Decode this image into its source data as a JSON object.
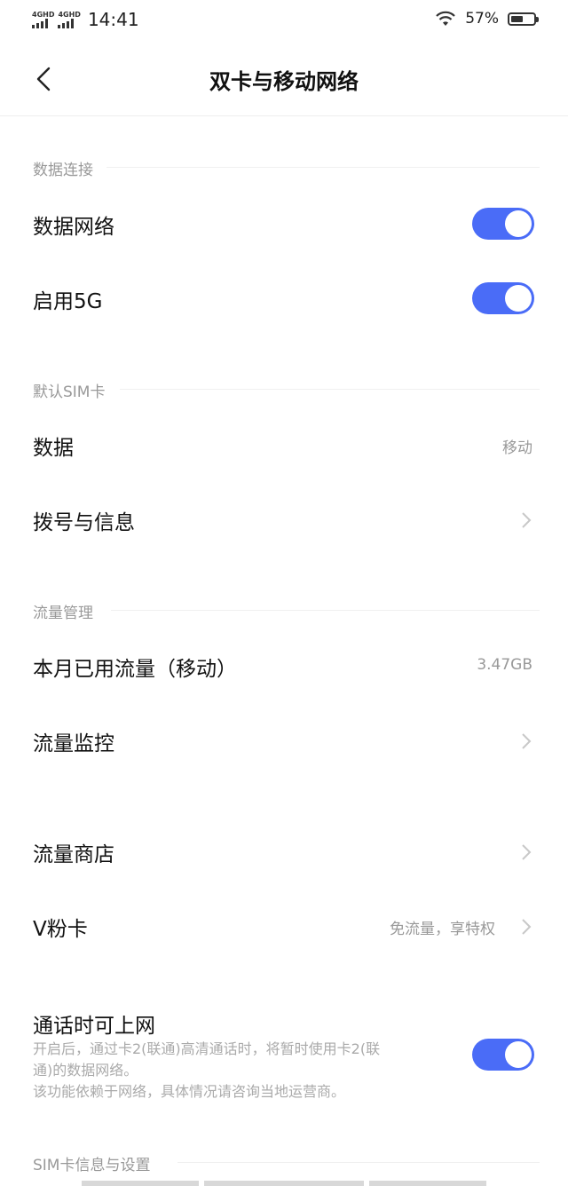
{
  "status_bar": {
    "signal1_label": "4GHD",
    "signal2_label": "4GHD",
    "time": "14:41",
    "battery_percent": "57%",
    "battery_level": 0.57,
    "icons": [
      "signal-icon",
      "wifi-icon",
      "battery-icon"
    ]
  },
  "header": {
    "title": "双卡与移动网络",
    "back_icon": "chevron-left-icon"
  },
  "sections": {
    "data_connection": {
      "title": "数据连接",
      "data_network": {
        "label": "数据网络",
        "enabled": true
      },
      "enable_5g": {
        "label": "启用5G",
        "enabled": true
      }
    },
    "default_sim": {
      "title": "默认SIM卡",
      "data": {
        "label": "数据",
        "value": "移动"
      },
      "dial_sms": {
        "label": "拨号与信息"
      }
    },
    "traffic_management": {
      "title": "流量管理",
      "monthly_usage": {
        "label": "本月已用流量（移动）",
        "value": "3.47GB"
      },
      "traffic_monitor": {
        "label": "流量监控"
      },
      "traffic_store": {
        "label": "流量商店"
      },
      "v_fan_card": {
        "label": "V粉卡",
        "value": "免流量，享特权"
      },
      "call_internet": {
        "label": "通话时可上网",
        "description_line1": "开启后，通过卡2(联通)高清通话时，将暂时使用卡2(联",
        "description_line2": "通)的数据网络。",
        "description_line3": "该功能依赖于网络，具体情况请咨询当地运营商。",
        "enabled": true
      }
    },
    "sim_info": {
      "title": "SIM卡信息与设置"
    }
  },
  "colors": {
    "accent": "#4a6cf7",
    "secondary_text": "#999999"
  }
}
